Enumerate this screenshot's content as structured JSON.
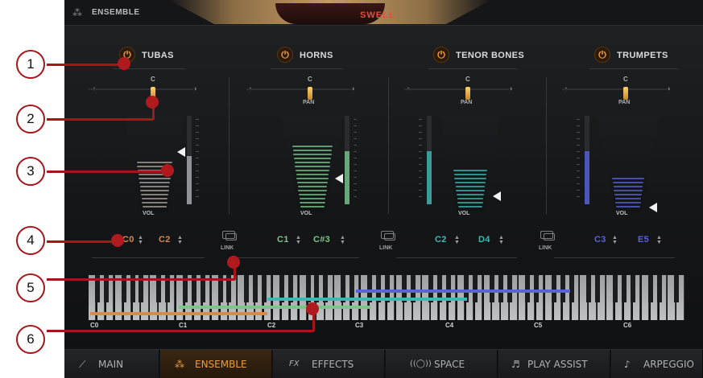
{
  "header": {
    "title": "ENSEMBLE",
    "swell_label": "SWELL"
  },
  "instruments": [
    {
      "name": "TUBAS",
      "pan_center": "C",
      "pan_label": "",
      "vol_label": "VOL",
      "range_low": "C0",
      "range_high": "C2",
      "color": "#d58a4e",
      "meter_level": 0.55
    },
    {
      "name": "HORNS",
      "pan_center": "C",
      "pan_label": "PAN",
      "vol_label": "VOL",
      "range_low": "C1",
      "range_high": "C#3",
      "color": "#78c788",
      "meter_level": 0.6
    },
    {
      "name": "TENOR BONES",
      "pan_center": "C",
      "pan_label": "PAN",
      "vol_label": "VOL",
      "range_low": "C2",
      "range_high": "D4",
      "color": "#3ab9b3",
      "meter_level": 0.6
    },
    {
      "name": "TRUMPETS",
      "pan_center": "C",
      "pan_label": "PAN",
      "vol_label": "VOL",
      "range_low": "C3",
      "range_high": "E5",
      "color": "#5a63d6",
      "meter_level": 0.6
    }
  ],
  "link_label": "LINK",
  "keyboard": {
    "octave_labels": [
      "C0",
      "C1",
      "C2",
      "C3",
      "C4",
      "C5",
      "C6"
    ]
  },
  "nav": {
    "tabs": [
      {
        "label": "MAIN",
        "icon": "mic-icon",
        "active": false
      },
      {
        "label": "ENSEMBLE",
        "icon": "ensemble-icon",
        "active": true
      },
      {
        "label": "EFFECTS",
        "icon": "fx-icon",
        "active": false
      },
      {
        "label": "SPACE",
        "icon": "space-icon",
        "active": false
      },
      {
        "label": "PLAY ASSIST",
        "icon": "play-assist-icon",
        "active": false
      },
      {
        "label": "ARPEGGIO",
        "icon": "arpeggio-icon",
        "active": false
      }
    ]
  },
  "annotations": [
    "1",
    "2",
    "3",
    "4",
    "5",
    "6"
  ],
  "colors": {
    "annotation": "#a8141a",
    "accent": "#ef9b3a"
  }
}
